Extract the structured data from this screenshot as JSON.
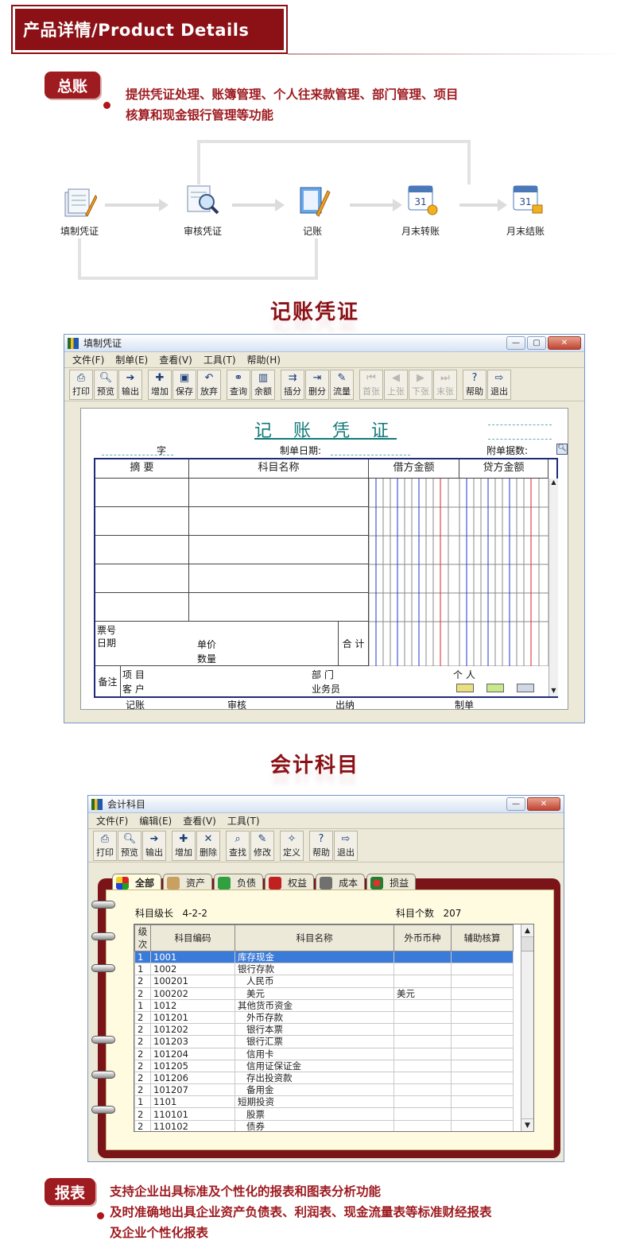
{
  "header": {
    "title": "产品详情/Product Details"
  },
  "ledger": {
    "tag": "总账",
    "desc_line1": "提供凭证处理、账簿管理、个人往来款管理、部门管理、项目",
    "desc_line2": "核算和现金银行管理等功能"
  },
  "flow": {
    "steps": [
      "填制凭证",
      "审核凭证",
      "记账",
      "月末转账",
      "月末结账"
    ]
  },
  "voucher_section": {
    "title": "记账凭证"
  },
  "voucher_window": {
    "title": "填制凭证",
    "menus": [
      "文件(F)",
      "制单(E)",
      "查看(V)",
      "工具(T)",
      "帮助(H)"
    ],
    "toolbar": [
      "打印",
      "预览",
      "输出",
      "增加",
      "保存",
      "放弃",
      "查询",
      "余额",
      "插分",
      "删分",
      "流量",
      "首张",
      "上张",
      "下张",
      "末张",
      "帮助",
      "退出"
    ],
    "voucher_title": "记 账 凭 证",
    "word_label": "字",
    "date_label": "制单日期:",
    "attach_label": "附单据数:",
    "col_summary": "摘 要",
    "col_account": "科目名称",
    "col_debit": "借方金额",
    "col_credit": "贷方金额",
    "ticket_no": "票号",
    "ticket_date": "日期",
    "unit_price": "单价",
    "quantity": "数量",
    "total": "合 计",
    "remark": "备注",
    "project": "项 目",
    "customer": "客 户",
    "department": "部 门",
    "salesman": "业务员",
    "person": "个 人",
    "sign_post": "记账",
    "sign_audit": "审核",
    "sign_cashier": "出纳",
    "sign_maker": "制单"
  },
  "accounts_section": {
    "title": "会计科目"
  },
  "accounts_window": {
    "title": "会计科目",
    "menus": [
      "文件(F)",
      "编辑(E)",
      "查看(V)",
      "工具(T)"
    ],
    "toolbar": [
      "打印",
      "预览",
      "输出",
      "增加",
      "删除",
      "查找",
      "修改",
      "定义",
      "帮助",
      "退出"
    ],
    "tabs": [
      "全部",
      "资产",
      "负债",
      "权益",
      "成本",
      "损益"
    ],
    "level_label": "科目级长",
    "level_value": "4-2-2",
    "count_label": "科目个数",
    "count_value": "207",
    "columns": [
      "级次",
      "科目编码",
      "科目名称",
      "外币币种",
      "辅助核算"
    ],
    "rows": [
      [
        "1",
        "1001",
        "库存现金",
        "",
        ""
      ],
      [
        "1",
        "1002",
        "银行存款",
        "",
        ""
      ],
      [
        "2",
        "100201",
        "人民币",
        "",
        ""
      ],
      [
        "2",
        "100202",
        "美元",
        "美元",
        ""
      ],
      [
        "1",
        "1012",
        "其他货币资金",
        "",
        ""
      ],
      [
        "2",
        "101201",
        "外币存款",
        "",
        ""
      ],
      [
        "2",
        "101202",
        "银行本票",
        "",
        ""
      ],
      [
        "2",
        "101203",
        "银行汇票",
        "",
        ""
      ],
      [
        "2",
        "101204",
        "信用卡",
        "",
        ""
      ],
      [
        "2",
        "101205",
        "信用证保证金",
        "",
        ""
      ],
      [
        "2",
        "101206",
        "存出投资款",
        "",
        ""
      ],
      [
        "2",
        "101207",
        "备用金",
        "",
        ""
      ],
      [
        "1",
        "1101",
        "短期投资",
        "",
        ""
      ],
      [
        "2",
        "110101",
        "股票",
        "",
        ""
      ],
      [
        "2",
        "110102",
        "债券",
        "",
        ""
      ]
    ]
  },
  "report": {
    "tag": "报表",
    "desc_line1": "支持企业出具标准及个性化的报表和图表分析功能",
    "desc_line2": "及时准确地出具企业资产负债表、利润表、现金流量表等标准财经报表",
    "desc_line3": "及企业个性化报表"
  }
}
